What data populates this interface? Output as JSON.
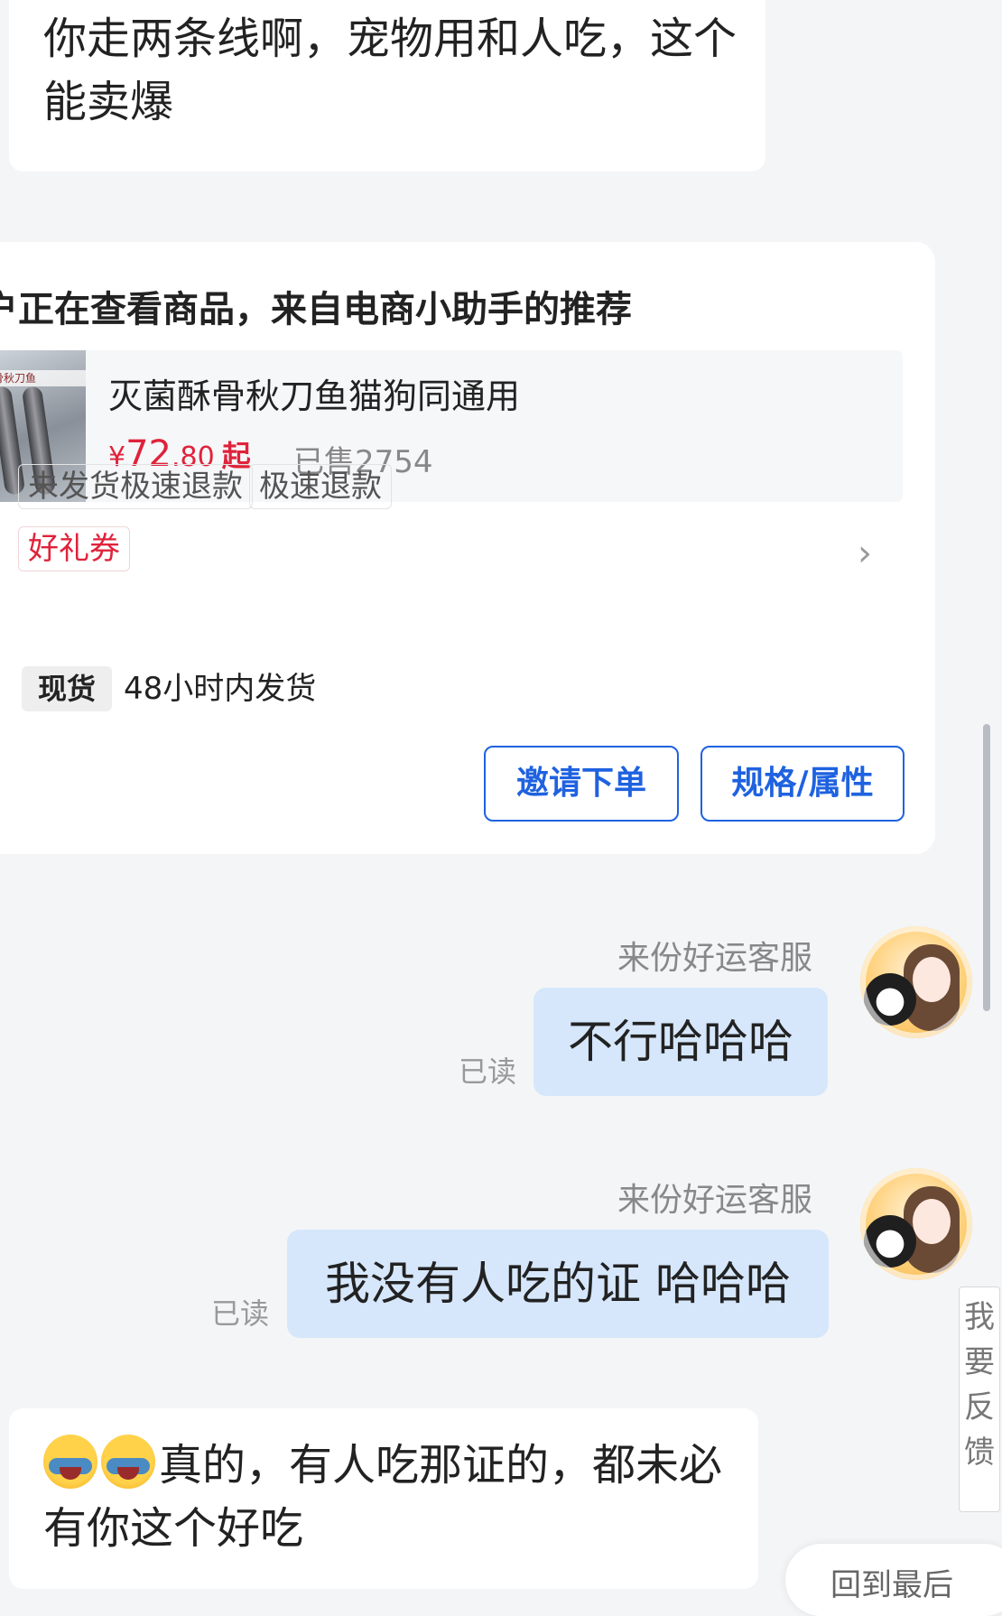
{
  "messages": {
    "top_incoming": "你走两条线啊，宠物用和人吃，这个能卖爆",
    "bottom_incoming": "真的，有人吃那证的，都未必有你这个好吃",
    "outgoing": [
      {
        "sender": "来份好运客服",
        "text": "不行哈哈哈",
        "status": "已读"
      },
      {
        "sender": "来份好运客服",
        "text": "我没有人吃的证 哈哈哈",
        "status": "已读"
      }
    ]
  },
  "product_card": {
    "header": "户正在查看商品，来自电商小助手的推荐",
    "thumb_caption": "酥骨秋刀鱼",
    "name": "灭菌酥骨秋刀鱼猫狗同通用",
    "price": {
      "currency": "¥",
      "integer": "72",
      "decimal": ".80",
      "suffix": "起"
    },
    "sold": "已售2754",
    "tags": [
      "未发货极速退款",
      "极速退款"
    ],
    "coupon": "好礼券",
    "stock_badge": "现货",
    "stock_text": "48小时内发货",
    "buttons": {
      "invite": "邀请下单",
      "spec": "规格/属性"
    }
  },
  "feedback_button": [
    "我",
    "要",
    "反",
    "馈"
  ],
  "back_to_last": "回到最后",
  "icons": {
    "chevron": "chevron-right-icon",
    "avatar": "avatar-icon",
    "emoji": "rofl-emoji-icon"
  },
  "colors": {
    "accent_blue": "#1f62e0",
    "price_red": "#e0223a",
    "outgoing_bubble": "#d6e7fb",
    "background": "#f4f5f7"
  }
}
